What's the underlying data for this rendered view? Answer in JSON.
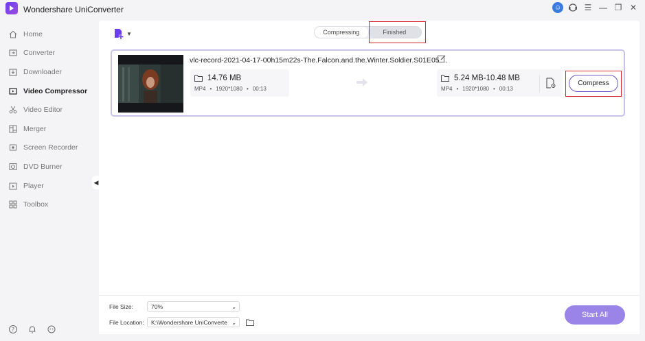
{
  "app": {
    "title": "Wondershare UniConverter"
  },
  "sidebar": {
    "items": [
      {
        "label": "Home",
        "icon": "home-icon"
      },
      {
        "label": "Converter",
        "icon": "converter-icon"
      },
      {
        "label": "Downloader",
        "icon": "downloader-icon"
      },
      {
        "label": "Video Compressor",
        "icon": "compress-icon",
        "active": true
      },
      {
        "label": "Video Editor",
        "icon": "scissors-icon"
      },
      {
        "label": "Merger",
        "icon": "merger-icon"
      },
      {
        "label": "Screen Recorder",
        "icon": "record-icon"
      },
      {
        "label": "DVD Burner",
        "icon": "disc-icon"
      },
      {
        "label": "Player",
        "icon": "play-icon"
      },
      {
        "label": "Toolbox",
        "icon": "grid-icon"
      }
    ]
  },
  "tabs": {
    "compressing": "Compressing",
    "finished": "Finished"
  },
  "file": {
    "name": "vlc-record-2021-04-17-00h15m22s-The.Falcon.and.the.Winter.Soldier.S01E05....",
    "source": {
      "size": "14.76 MB",
      "format": "MP4",
      "resolution": "1920*1080",
      "duration": "00:13"
    },
    "target": {
      "size": "5.24 MB-10.48 MB",
      "format": "MP4",
      "resolution": "1920*1080",
      "duration": "00:13"
    },
    "compress_label": "Compress"
  },
  "bottom": {
    "file_size_label": "File Size:",
    "file_size_value": "70%",
    "file_location_label": "File Location:",
    "file_location_value": "K:\\Wondershare UniConverte",
    "start_all_label": "Start All"
  },
  "colors": {
    "accent": "#6a58c7",
    "start_all_bg": "#9a84e8",
    "highlight": "#d7262e"
  }
}
